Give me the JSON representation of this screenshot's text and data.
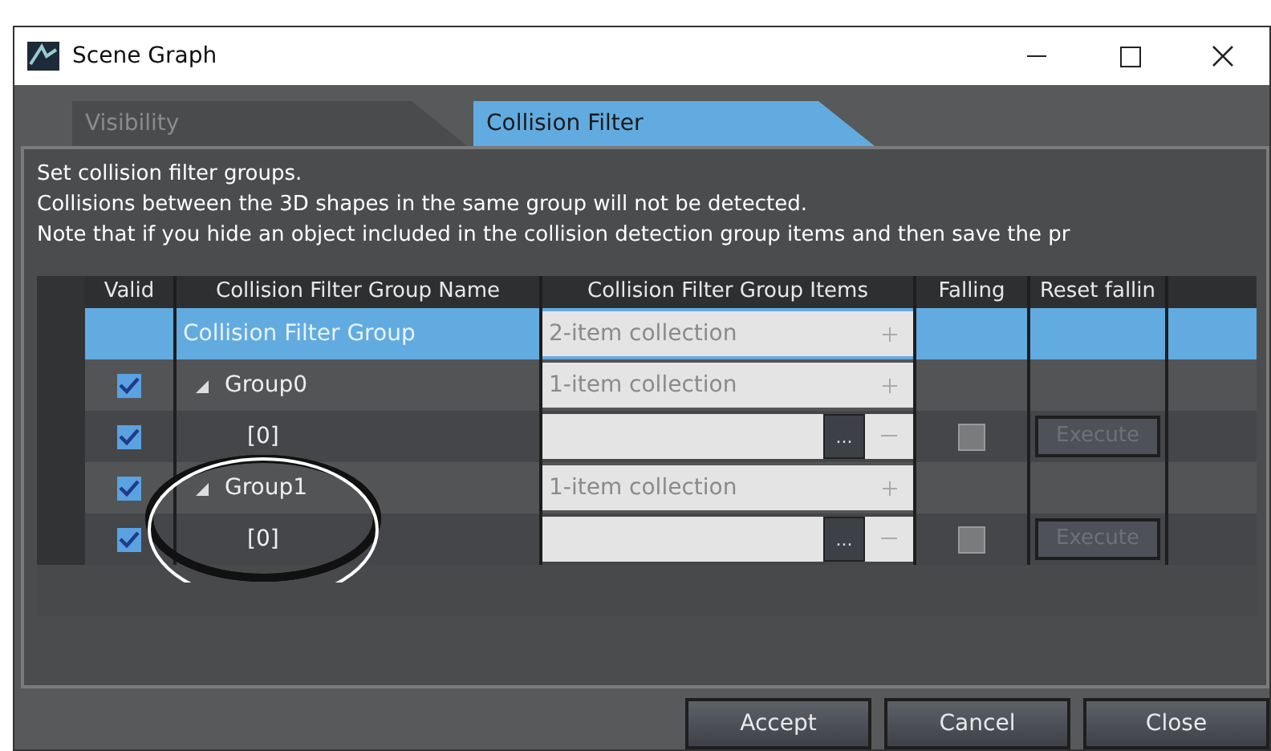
{
  "window": {
    "title": "Scene Graph"
  },
  "tabs": [
    {
      "label": "Visibility",
      "selected": false
    },
    {
      "label": "Collision Filter",
      "selected": true
    }
  ],
  "description": [
    "Set collision filter groups.",
    "Collisions between the 3D shapes in the same group will not be detected.",
    "Note that if you hide an object included in the collision detection group items and then save the pr"
  ],
  "table": {
    "columns": [
      "Valid",
      "Collision Filter Group Name",
      "Collision Filter Group Items",
      "Falling",
      "Reset fallin"
    ],
    "rows": [
      {
        "kind": "root",
        "name": "Collision Filter Group",
        "items": "2-item collection",
        "selected": true,
        "children": [
          {
            "kind": "group",
            "name": "Group0",
            "valid": true,
            "expanded": true,
            "items": "1-item collection",
            "selected": false,
            "children": [
              {
                "kind": "item",
                "name": "[0]",
                "valid": true,
                "browse": "...",
                "falling": false,
                "action": "Execute",
                "selected": false
              }
            ]
          },
          {
            "kind": "group",
            "name": "Group1",
            "valid": true,
            "expanded": true,
            "items": "1-item collection",
            "selected": false,
            "children": [
              {
                "kind": "item",
                "name": "[0]",
                "valid": true,
                "browse": "...",
                "falling": false,
                "action": "Execute",
                "selected": false
              }
            ]
          }
        ]
      }
    ]
  },
  "buttons": [
    "Accept",
    "Cancel",
    "Close"
  ]
}
